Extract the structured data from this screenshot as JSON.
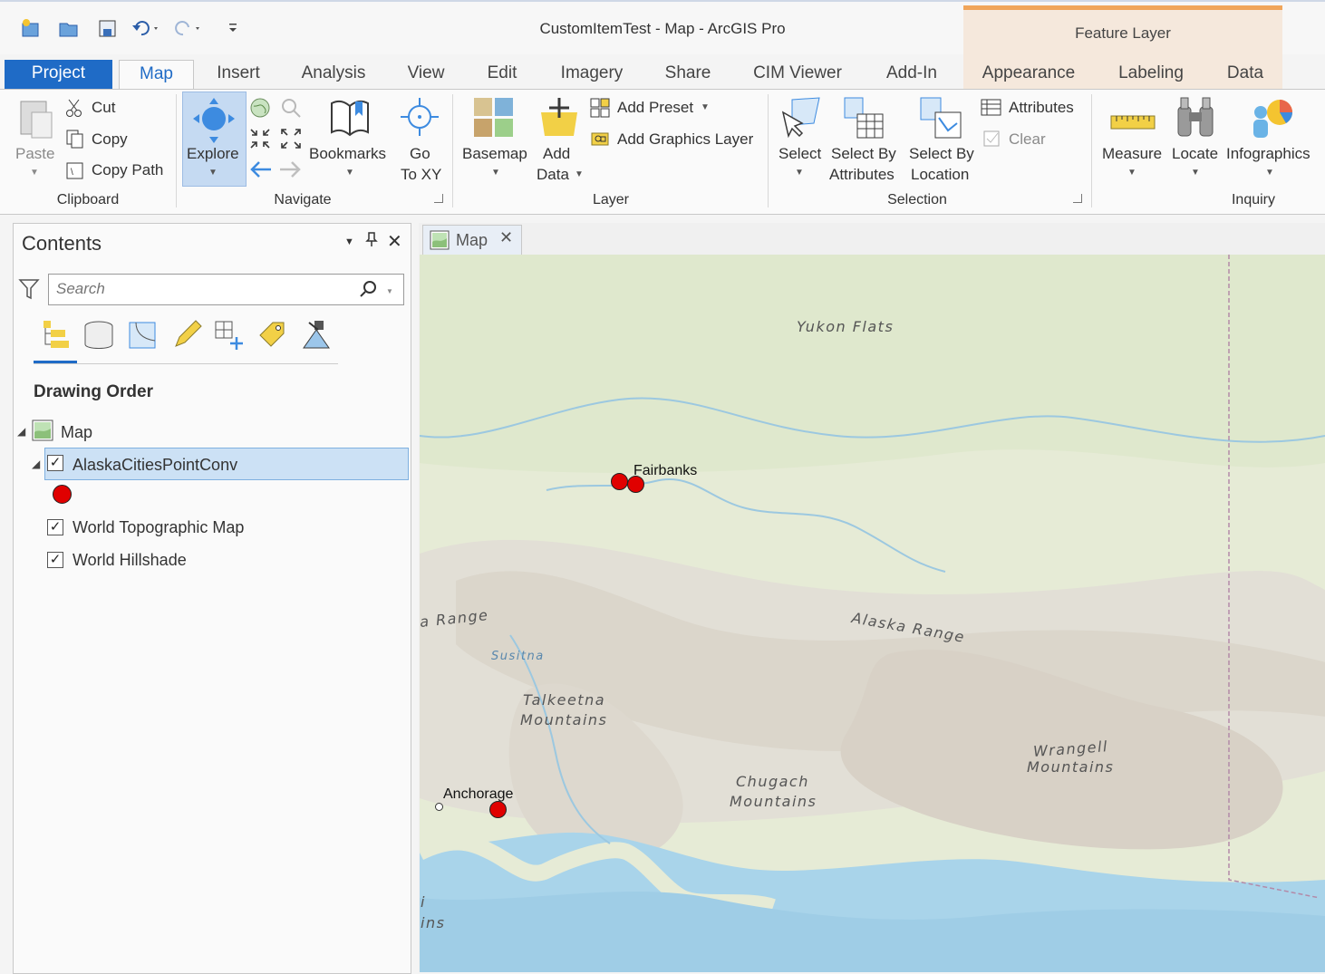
{
  "app": {
    "title": "CustomItemTest - Map - ArcGIS Pro",
    "context_tab_group": "Feature Layer"
  },
  "quick_access": [
    "new-project-icon",
    "open-project-icon",
    "save-project-icon",
    "undo-icon",
    "redo-icon",
    "customize-icon"
  ],
  "tabs": {
    "project": "Project",
    "items": [
      "Map",
      "Insert",
      "Analysis",
      "View",
      "Edit",
      "Imagery",
      "Share",
      "CIM Viewer",
      "Add-In"
    ],
    "context": [
      "Appearance",
      "Labeling",
      "Data"
    ]
  },
  "ribbon": {
    "clipboard": {
      "paste": "Paste",
      "cut": "Cut",
      "copy": "Copy",
      "copy_path": "Copy Path",
      "group": "Clipboard"
    },
    "navigate": {
      "explore": "Explore",
      "bookmarks": "Bookmarks",
      "goto_1": "Go",
      "goto_2": "To XY",
      "group": "Navigate"
    },
    "layer": {
      "basemap": "Basemap",
      "add_data_1": "Add",
      "add_data_2": "Data",
      "add_preset": "Add Preset",
      "add_graphics": "Add Graphics Layer",
      "group": "Layer"
    },
    "selection": {
      "select": "Select",
      "sel_attr_1": "Select By",
      "sel_attr_2": "Attributes",
      "sel_loc_1": "Select By",
      "sel_loc_2": "Location",
      "attributes": "Attributes",
      "clear": "Clear",
      "group": "Selection"
    },
    "inquiry": {
      "measure": "Measure",
      "locate": "Locate",
      "infographics": "Infographics",
      "group": "Inquiry"
    }
  },
  "contents": {
    "title": "Contents",
    "search_placeholder": "Search",
    "drawing_order": "Drawing Order",
    "tree": {
      "map": "Map",
      "layer": "AlaskaCitiesPointConv",
      "topo": "World Topographic Map",
      "hillshade": "World Hillshade"
    },
    "checked": {
      "layer": true,
      "topo": true,
      "hillshade": true
    }
  },
  "map_view": {
    "tab_label": "Map",
    "labels": {
      "yukon": "Yukon Flats",
      "alaska_range_left": "a Range",
      "alaska_range": "Alaska Range",
      "susitna": "Susitna",
      "talkeetna_1": "Talkeetna",
      "talkeetna_2": "Mountains",
      "wrangell_1": "Wrangell",
      "wrangell_2": "Mountains",
      "chugach_1": "Chugach",
      "chugach_2": "Mountains",
      "edge_i": "i",
      "edge_ins": "ins"
    },
    "cities": {
      "fairbanks": "Fairbanks",
      "anchorage": "Anchorage"
    },
    "point_color": "#e00000",
    "selection_color": "#cce1f5",
    "accent": "#1f6bc6"
  }
}
